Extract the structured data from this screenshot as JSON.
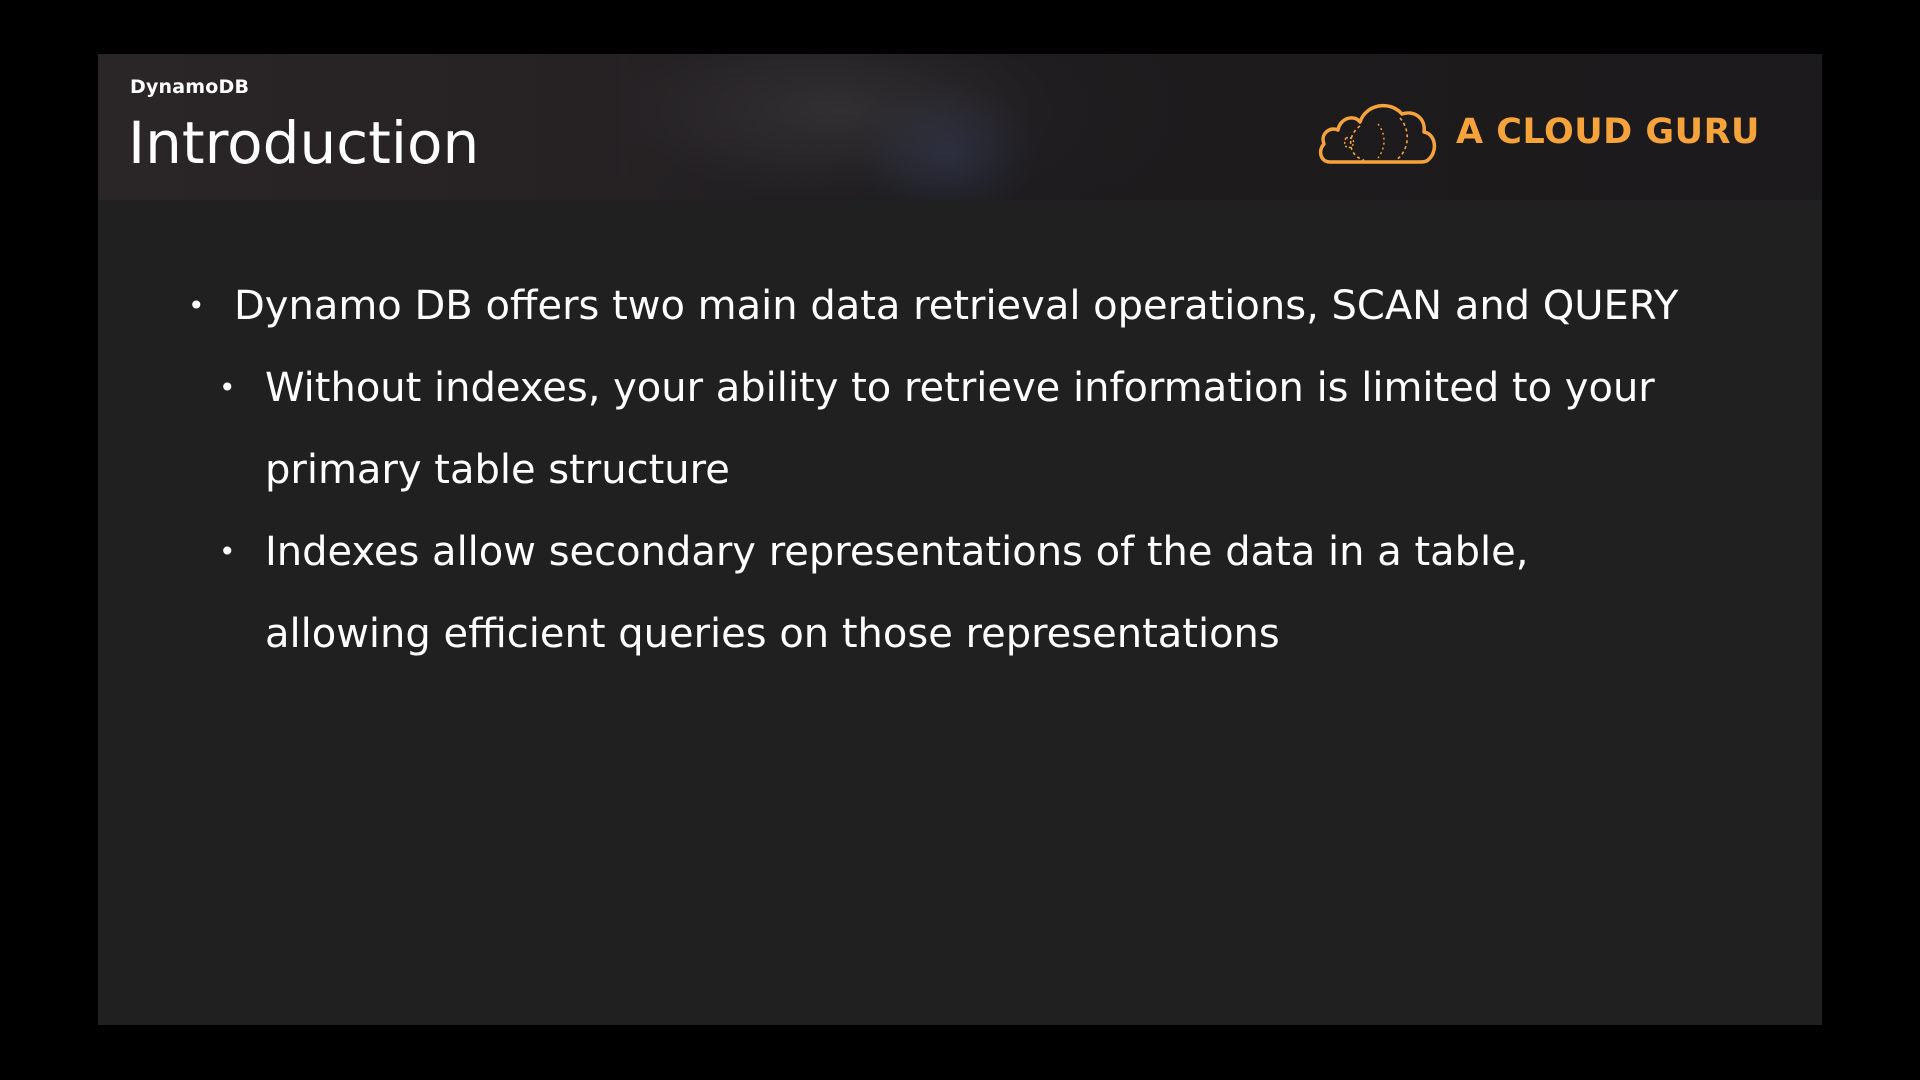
{
  "header": {
    "section_label": "DynamoDB",
    "title": "Introduction"
  },
  "logo": {
    "text": "A CLOUD GURU",
    "icon": "cloud-icon",
    "color": "#f6a33c"
  },
  "bullets": [
    {
      "level": 1,
      "text": "Dynamo DB offers two main data retrieval operations, SCAN and QUERY"
    },
    {
      "level": 2,
      "text": "Without indexes, your ability to retrieve information is limited to your primary table structure"
    },
    {
      "level": 2,
      "text": "Indexes allow secondary representations of the data in a table, allowing efficient queries on those representations"
    }
  ],
  "bullet_symbol": "•"
}
